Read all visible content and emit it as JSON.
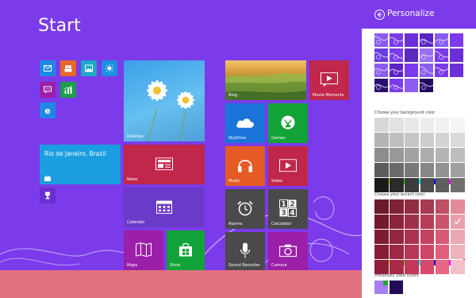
{
  "start": {
    "title": "Start",
    "tiles": {
      "desktop": "Desktop",
      "weather": "Rio de Janeiro, Brazil",
      "news": "News",
      "calendar": "Calendar",
      "maps": "Maps",
      "store": "Store",
      "bing": "Bing",
      "movie_moments": "Movie Moments",
      "skydrive": "SkyDrive",
      "games": "Games",
      "music": "Music",
      "video": "Video",
      "alarms": "Alarms",
      "calculator": "Calculator",
      "sound_recorder": "Sound Recorder",
      "camera": "Camera"
    },
    "small_icons": [
      "mail-icon",
      "people-icon",
      "photos-icon",
      "weather-sun-icon",
      "messaging-icon",
      "finance-icon",
      "internet-explorer-icon",
      "trophy-icon"
    ]
  },
  "charm": {
    "title": "Personalize",
    "bg_color_label": "Choose your background color",
    "accent_color_label": "Choose your accent color",
    "previous_label": "Previously used colors",
    "pattern_colors": [
      "#8a5cf0",
      "#7b3bea",
      "#6b2fd8",
      "#5a24c4",
      "#8a5cf0",
      "#7b3bea",
      "#6a3de0",
      "#7b3bea",
      "#5b2bbd",
      "#9a70f2",
      "#7b3bea",
      "#6b2fd8",
      "#8a5cf0",
      "#5a24c4",
      "#7b3bea",
      "#8a5cf0",
      "#7b3bea",
      "#6b2fd8",
      "#2a1070",
      "#7b3bea",
      "#8a5cf0",
      "#230a5c"
    ],
    "bg_swatches": [
      "#d8d8d8",
      "#e2e2e2",
      "#e8e8e8",
      "#ececec",
      "#f0f0f0",
      "#f4f4f4",
      "#b4b4b4",
      "#bebebe",
      "#c6c6c6",
      "#cdcdcd",
      "#d4d4d4",
      "#dadada",
      "#8d8d8d",
      "#989898",
      "#a2a2a2",
      "#acacac",
      "#b4b4b4",
      "#bdbdbd",
      "#5c5c5c",
      "#6a6a6a",
      "#787878",
      "#868686",
      "#939393",
      "#a0a0a0",
      "#1a1a1a",
      "#2b2b2b",
      "#3c3c3c",
      "#4d4d4d",
      "#5e5e5e",
      "#6f6f6f"
    ],
    "accent_swatches": [
      "#6b1a2c",
      "#7f2236",
      "#932d42",
      "#a83b52",
      "#bd5063",
      "#e48b9a",
      "#741a30",
      "#8a243b",
      "#a03049",
      "#b73e58",
      "#cb546d",
      "#e8a0ac",
      "#7c1c33",
      "#932641",
      "#ac324f",
      "#c3425f",
      "#d75975",
      "#eba8b4",
      "#851d36",
      "#9d2846",
      "#b73555",
      "#ce4666",
      "#e05f7c",
      "#efb3be",
      "#8e1e39",
      "#a72a4a",
      "#c2375a",
      "#d8496c",
      "#e86683",
      "#f3c0c9"
    ],
    "previous_colors": [
      "#a87ff3",
      "#240a56"
    ]
  }
}
